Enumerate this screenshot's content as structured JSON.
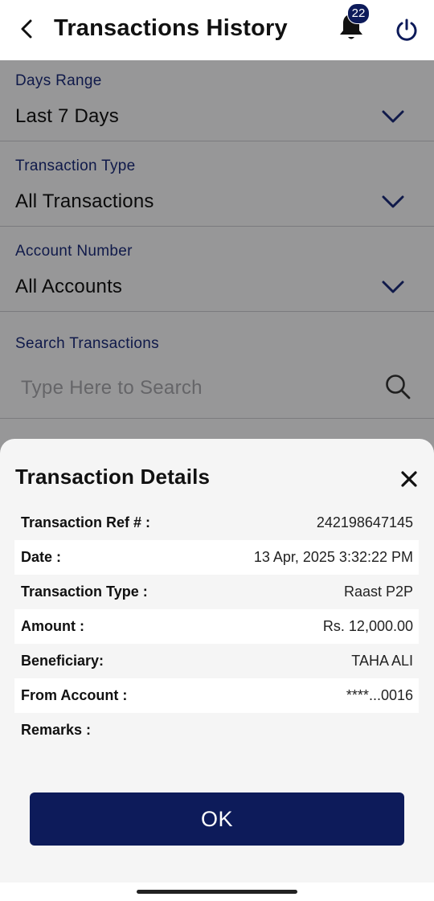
{
  "header": {
    "title": "Transactions History",
    "notification_count": "22"
  },
  "filters": {
    "days_range": {
      "label": "Days Range",
      "value": "Last 7 Days"
    },
    "transaction_type": {
      "label": "Transaction Type",
      "value": "All Transactions"
    },
    "account_number": {
      "label": "Account Number",
      "value": "All Accounts"
    },
    "search": {
      "label": "Search Transactions",
      "placeholder": "Type Here to Search"
    }
  },
  "details": {
    "title": "Transaction Details",
    "rows": [
      {
        "label": "Transaction Ref # :",
        "value": "242198647145"
      },
      {
        "label": "Date :",
        "value": "13 Apr, 2025 3:32:22 PM"
      },
      {
        "label": "Transaction Type :",
        "value": "Raast P2P"
      },
      {
        "label": "Amount :",
        "value": "Rs. 12,000.00"
      },
      {
        "label": "Beneficiary:",
        "value": "TAHA ALI"
      },
      {
        "label": "From Account :",
        "value": "****...0016"
      },
      {
        "label": "Remarks :",
        "value": ""
      }
    ],
    "ok_label": "OK"
  },
  "colors": {
    "brand_navy": "#0d1b5a",
    "label_blue": "#1a2a78"
  },
  "icons": [
    "back-arrow-icon",
    "bell-icon",
    "power-icon",
    "chevron-down-icon",
    "search-icon",
    "close-icon"
  ]
}
